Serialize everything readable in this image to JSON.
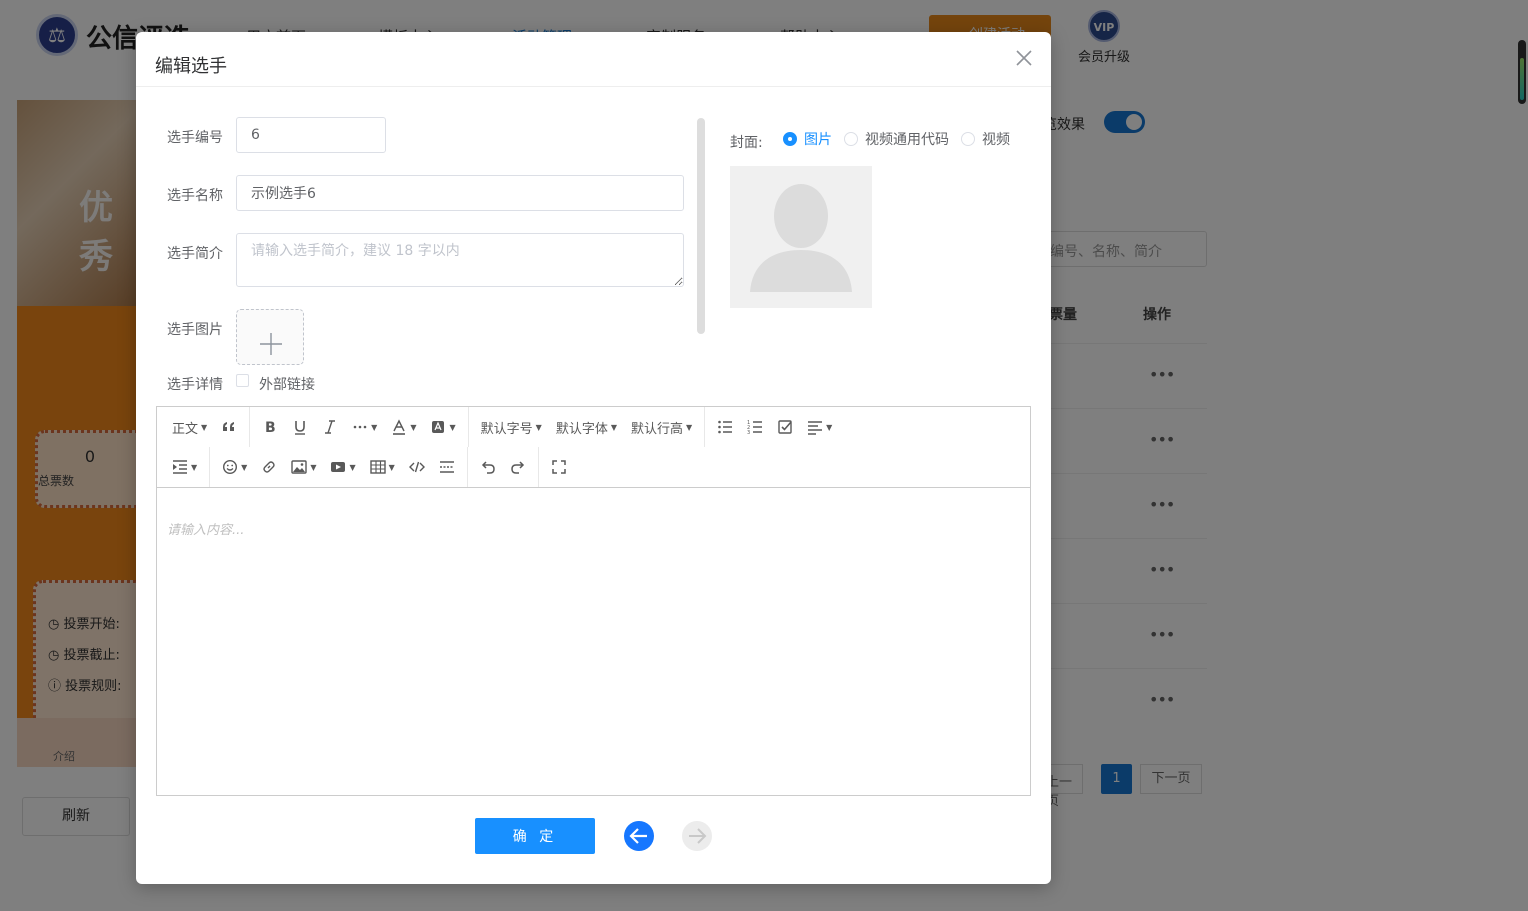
{
  "background": {
    "brand": "公信评选",
    "nav": [
      "用户首页",
      "模板中心",
      "活动管理",
      "定制服务",
      "帮助中心"
    ],
    "active_nav_index": 2,
    "create_button": "创建活动",
    "vip_label": "会员升级",
    "vip_badge": "VIP",
    "preview": {
      "banner": "优秀",
      "total_votes_num": "0",
      "total_votes_label": "总票数",
      "vote_start": "投票开始:",
      "vote_end": "投票截止:",
      "vote_rules": "投票规则:",
      "footer_tab": "介绍"
    },
    "refresh_button": "刷新",
    "effect_label": "览效果",
    "search_placeholder": "编号、名称、简介",
    "columns": [
      "票量",
      "操作"
    ],
    "row_action": "•••",
    "pager": {
      "prev": "上一页",
      "current": "1",
      "next": "下一页"
    }
  },
  "dialog": {
    "title": "编辑选手",
    "fields": {
      "number_label": "选手编号",
      "number_value": "6",
      "name_label": "选手名称",
      "name_value": "示例选手6",
      "intro_label": "选手简介",
      "intro_placeholder": "请输入选手简介，建议 18 字以内",
      "image_label": "选手图片",
      "detail_label": "选手详情",
      "external_link_label": "外部链接"
    },
    "cover": {
      "label": "封面:",
      "options": [
        "图片",
        "视频通用代码",
        "视频"
      ],
      "selected_index": 0
    },
    "editor": {
      "paragraph": "正文",
      "font_size": "默认字号",
      "font_family": "默认字体",
      "line_height": "默认行高",
      "placeholder": "请输入内容..."
    },
    "confirm_button": "确 定"
  },
  "colors": {
    "primary": "#1890ff",
    "accent_orange": "#e9891b",
    "mask": "rgba(0,0,0,0.5)"
  }
}
